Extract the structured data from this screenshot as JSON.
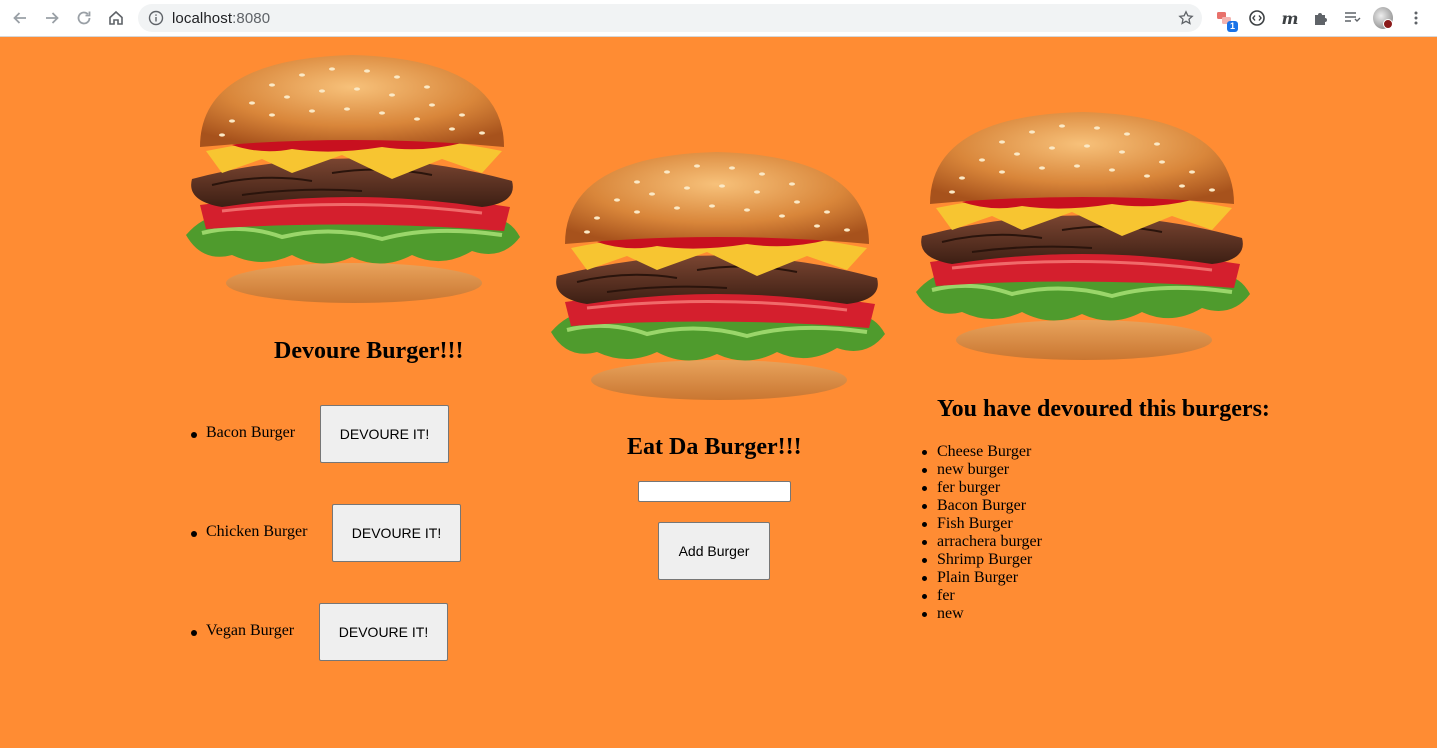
{
  "browser": {
    "url_host": "localhost",
    "url_port": ":8080",
    "extension_badge": "1",
    "extension_m_label": "m"
  },
  "colors": {
    "page_background": "#ff8c33",
    "button_background": "#efefef"
  },
  "left_column": {
    "heading": "Devoure Burger!!!",
    "burgers": [
      {
        "name": "Bacon Burger",
        "button_label": "DEVOURE IT!"
      },
      {
        "name": "Chicken Burger",
        "button_label": "DEVOURE IT!"
      },
      {
        "name": "Vegan Burger",
        "button_label": "DEVOURE IT!"
      }
    ]
  },
  "center_column": {
    "heading": "Eat Da Burger!!!",
    "input_value": "",
    "add_button_label": "Add Burger"
  },
  "right_column": {
    "heading": "You have devoured this burgers:",
    "devoured": [
      "Cheese Burger",
      "new burger",
      "fer burger",
      "Bacon Burger",
      "Fish Burger",
      "arrachera burger",
      "Shrimp Burger",
      "Plain Burger",
      "fer",
      "new"
    ]
  }
}
